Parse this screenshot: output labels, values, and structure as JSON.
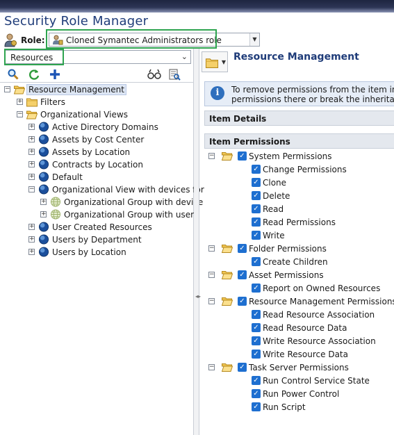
{
  "app": {
    "title": "Security Role Manager"
  },
  "role": {
    "label": "Role:",
    "selected": "Cloned Symantec Administrators role"
  },
  "left": {
    "resource_select": "Resources",
    "tree": [
      {
        "label": "Resource Management",
        "selected": true
      },
      {
        "label": "Filters"
      },
      {
        "label": "Organizational Views"
      },
      {
        "label": "Active Directory Domains"
      },
      {
        "label": "Assets by Cost Center"
      },
      {
        "label": "Assets by Location"
      },
      {
        "label": "Contracts by Location"
      },
      {
        "label": "Default"
      },
      {
        "label": "Organizational View with devices for"
      },
      {
        "label": "Organizational Group with device"
      },
      {
        "label": "Organizational Group with users"
      },
      {
        "label": "User Created Resources"
      },
      {
        "label": "Users by Department"
      },
      {
        "label": "Users by Location"
      }
    ]
  },
  "right": {
    "title": "Resource Management",
    "info_line1": "To remove permissions from the item in ca",
    "info_line2": "permissions there or break the inheritance",
    "item_details": "Item Details",
    "item_permissions": "Item Permissions",
    "groups": [
      {
        "label": "System Permissions",
        "items": [
          "Change Permissions",
          "Clone",
          "Delete",
          "Read",
          "Read Permissions",
          "Write"
        ]
      },
      {
        "label": "Folder Permissions",
        "items": [
          "Create Children"
        ]
      },
      {
        "label": "Asset Permissions",
        "items": [
          "Report on Owned Resources"
        ]
      },
      {
        "label": "Resource Management Permissions",
        "items": [
          "Read Resource Association",
          "Read Resource Data",
          "Write Resource Association",
          "Write Resource Data"
        ]
      },
      {
        "label": "Task Server Permissions",
        "items": [
          "Run Control Service State",
          "Run Power Control",
          "Run Script"
        ]
      }
    ]
  },
  "colors": {
    "accent": "#1f3c79",
    "highlight": "#2ea44f",
    "checkbox": "#1e6fd0"
  }
}
